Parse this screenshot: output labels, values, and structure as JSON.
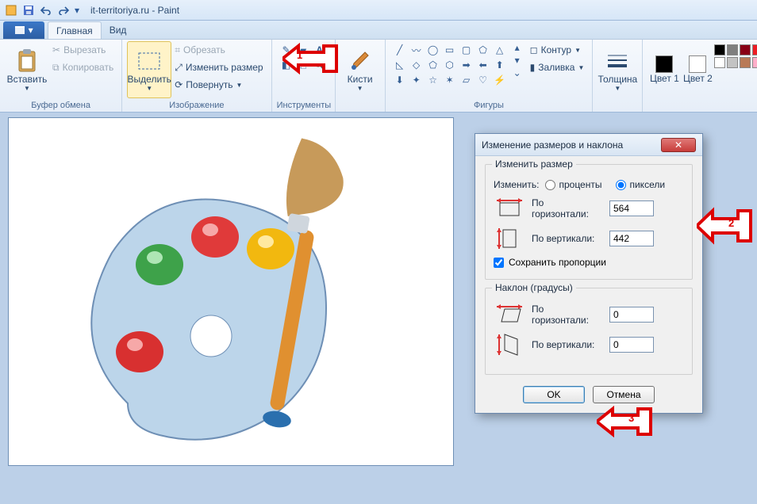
{
  "title": "it-territoriya.ru - Paint",
  "tabs": {
    "home": "Главная",
    "view": "Вид"
  },
  "groups": {
    "clipboard": {
      "label": "Буфер обмена",
      "paste": "Вставить",
      "cut": "Вырезать",
      "copy": "Копировать"
    },
    "image": {
      "label": "Изображение",
      "select": "Выделить",
      "crop": "Обрезать",
      "resize": "Изменить размер",
      "rotate": "Повернуть"
    },
    "tools": {
      "label": "Инструменты"
    },
    "brushes": {
      "label": "Кисти"
    },
    "shapes": {
      "label": "Фигуры",
      "outline": "Контур",
      "fill": "Заливка"
    },
    "thickness": {
      "label": "Толщина"
    },
    "colors": {
      "color1": "Цвет 1",
      "color2": "Цвет 2",
      "color1_value": "#000000",
      "color2_value": "#ffffff",
      "palette": [
        "#000000",
        "#7f7f7f",
        "#880015",
        "#ed1c24",
        "#ff7f27",
        "#fff200",
        "#ffffff",
        "#c3c3c3",
        "#b97a57",
        "#ffaec9",
        "#ffc90e",
        "#efe4b0"
      ]
    }
  },
  "dialog": {
    "title": "Изменение размеров и наклона",
    "resize_legend": "Изменить размер",
    "by_label": "Изменить:",
    "percent": "проценты",
    "pixels": "пиксели",
    "horizontal": "По горизонтали:",
    "vertical": "По вертикали:",
    "h_value": "564",
    "v_value": "442",
    "keep_ratio": "Сохранить пропорции",
    "skew_legend": "Наклон (градусы)",
    "skew_h": "0",
    "skew_v": "0",
    "ok": "OK",
    "cancel": "Отмена"
  },
  "callouts": {
    "n1": "1",
    "n2": "2",
    "n3": "3"
  }
}
